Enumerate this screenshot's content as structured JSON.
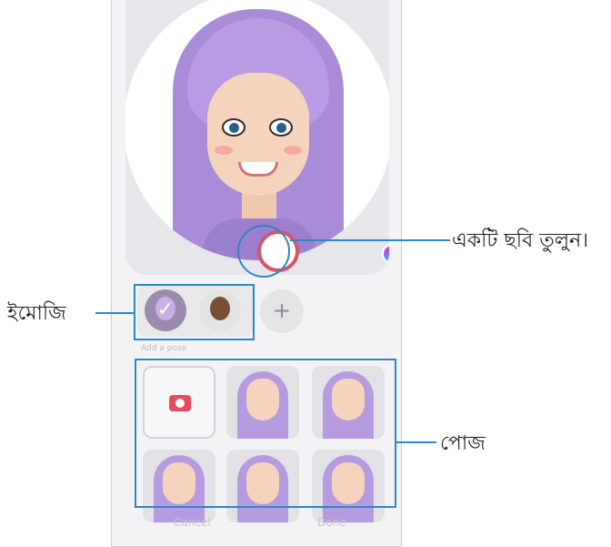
{
  "preview": {
    "capture_button": "capture-button",
    "color_button": "color-palette-button"
  },
  "emoji": {
    "section_label": "Add a pose",
    "items": [
      "selected emoji",
      "emoji 2"
    ]
  },
  "buttons": {
    "cancel": "Cancel",
    "done": "Done"
  },
  "callouts": {
    "capture": "একটি ছবি তুলুন।",
    "emoji": "ইমোজি",
    "poses": "পোজ"
  },
  "colors": {
    "accent": "#2f86c6",
    "capture_ring": "#d9536b",
    "camera_icon": "#e84a5f"
  }
}
